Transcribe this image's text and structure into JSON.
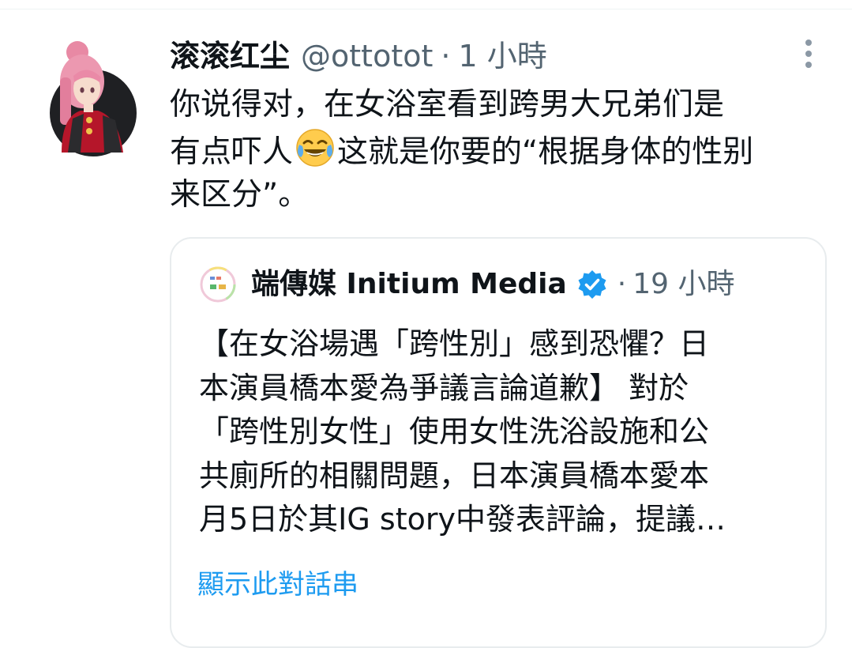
{
  "colors": {
    "text_primary": "#0f1419",
    "text_secondary": "#536471",
    "accent": "#1d9bf0",
    "verified": "#1d9bf0",
    "card_border": "#e8ecee"
  },
  "tweet": {
    "display_name": "滚滚红尘",
    "handle": "@ottotot",
    "separator": "·",
    "time": "1 小時",
    "text_lines": [
      "你说得对，在女浴室看到跨男大兄弟们是",
      "有点吓人",
      "这就是你要的“根据身体的性别",
      "来区分”。"
    ],
    "emoji": "face-with-tears-of-joy",
    "more_icon": "more-vertical-icon"
  },
  "quoted_tweet": {
    "display_name": "端傳媒 Initium Media",
    "verified_icon": "verified-badge-icon",
    "separator": "·",
    "time": "19 小時",
    "text_lines": [
      "【在女浴場遇「跨性別」感到恐懼？日",
      "本演員橋本愛為爭議言論道歉】 對於",
      "「跨性別女性」使用女性洗浴設施和公",
      "共廁所的相關問題，日本演員橋本愛本",
      "月5日於其IG story中發表評論，提議…"
    ],
    "show_thread_label": "顯示此對話串"
  }
}
